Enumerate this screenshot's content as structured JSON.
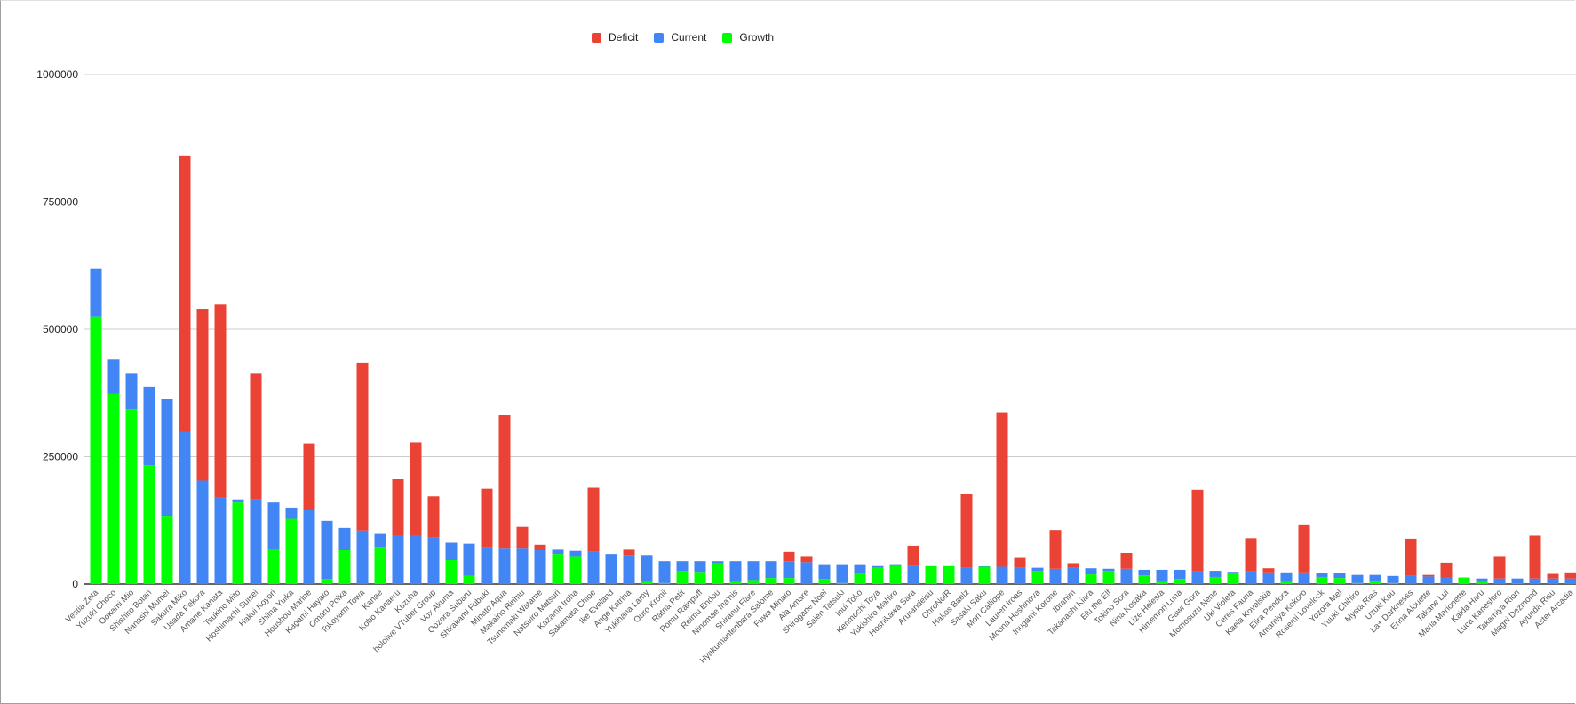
{
  "chart_data": {
    "type": "bar",
    "stacked": true,
    "title": "",
    "xlabel": "",
    "ylabel": "",
    "ylim": [
      0,
      1000000
    ],
    "yticks": [
      "0",
      "250000",
      "500000",
      "750000",
      "1000000"
    ],
    "grid": true,
    "legend_position": "top-center",
    "categories": [
      "Vestia Zeta",
      "Yuzuki Choco",
      "Ookami Mio",
      "Shishiro Botan",
      "Nanashi Mumei",
      "Sakura Miko",
      "Usada Pekora",
      "Amane Kanata",
      "Tsukino Mito",
      "Hoshimachi Suisei",
      "Hakui Koyori",
      "Shiina Yuika",
      "Houshou Marine",
      "Kagami Hayato",
      "Omaru Polka",
      "Tokoyami Towa",
      "Kanae",
      "Kobo Kanaeru",
      "Kuzuha",
      "hololive VTuber Group",
      "Vox Akuma",
      "Oozora Subaru",
      "Shirakami Fubuki",
      "Minato Aqua",
      "Makaino Ririmu",
      "Tsunomaki Watame",
      "Natsuiro Matsuri",
      "Kazama Iroha",
      "Sakamata Chloe",
      "Ike Eveland",
      "Ange Katrina",
      "Yukihana Lamy",
      "Ouro Kronii",
      "Ratna Petit",
      "Pomu Rainpuff",
      "Reimu Endou",
      "Ninomae Ina'nis",
      "Shiranui Flare",
      "Hyakumantenbara Salome",
      "Fuwa Minato",
      "Ala Amare",
      "Shirogane Noel",
      "Saien Tatsuki",
      "Inui Toko",
      "Kenmochi Toya",
      "Yukishiro Mahiro",
      "Hoshikawa Sara",
      "Arurandeisu",
      "ChroNoiR",
      "Hakos Baelz",
      "Sasaki Saku",
      "Mori Calliope",
      "Lauren Iroas",
      "Moona Hoshinova",
      "Inugami Korone",
      "Ibrahim",
      "Takanashi Kiara",
      "Elu the Elf",
      "Tokino Sora",
      "Nina Kosaka",
      "Lize Helesta",
      "Himemori Luna",
      "Gawr Gura",
      "Momosuzu Nene",
      "Uki Violeta",
      "Ceres Fauna",
      "Kaela Kovalskia",
      "Elira Pendora",
      "Amamiya Kokoro",
      "Rosemi Lovelock",
      "Yozora Mel",
      "Yuuki Chihiro",
      "Mysta Rias",
      "Uzuki Kou",
      "La+ Darknesss",
      "Enna Alouette",
      "Takane Lui",
      "Maria Marionette",
      "Kaida Haru",
      "Luca Kaneshiro",
      "Takamiya Rion",
      "Magni Dezmond",
      "Ayunda Risu",
      "Aster Arcadia"
    ],
    "series": [
      {
        "name": "Growth",
        "color": "#00ff00",
        "values": [
          525000,
          373000,
          343000,
          233000,
          134000,
          0,
          0,
          0,
          160000,
          0,
          69000,
          128000,
          0,
          10000,
          67000,
          0,
          73000,
          0,
          0,
          0,
          47000,
          16000,
          0,
          0,
          0,
          0,
          59000,
          55000,
          0,
          0,
          0,
          4000,
          2000,
          26000,
          24000,
          41000,
          4000,
          8000,
          12000,
          12000,
          0,
          10000,
          2000,
          22000,
          32000,
          37000,
          0,
          37000,
          37000,
          0,
          34000,
          0,
          0,
          26000,
          0,
          0,
          19000,
          26000,
          0,
          17000,
          4000,
          10000,
          0,
          14000,
          21000,
          0,
          0,
          4000,
          0,
          14000,
          12000,
          2000,
          5000,
          2000,
          0,
          0,
          0,
          13000,
          4000,
          0,
          1000,
          0,
          0,
          0
        ]
      },
      {
        "name": "Current",
        "color": "#4285f4",
        "values": [
          94000,
          69000,
          71000,
          154000,
          230000,
          298000,
          203000,
          170000,
          6000,
          166000,
          91000,
          22000,
          146000,
          114000,
          43000,
          105000,
          27000,
          95000,
          95000,
          91000,
          34000,
          63000,
          73000,
          71000,
          71000,
          67000,
          10000,
          10000,
          63000,
          59000,
          57000,
          53000,
          43000,
          19000,
          21000,
          4000,
          41000,
          37000,
          33000,
          33000,
          43000,
          29000,
          37000,
          17000,
          5000,
          2000,
          37000,
          0,
          0,
          33000,
          2000,
          34000,
          32000,
          6000,
          30000,
          33000,
          12000,
          4000,
          30000,
          11000,
          24000,
          18000,
          26000,
          12000,
          3000,
          25000,
          23000,
          19000,
          23000,
          7000,
          9000,
          16000,
          13000,
          14000,
          16000,
          15000,
          13000,
          0,
          7000,
          11000,
          10000,
          11000,
          11000,
          11000
        ]
      },
      {
        "name": "Deficit",
        "color": "#ea4335",
        "values": [
          0,
          0,
          0,
          0,
          0,
          542000,
          337000,
          380000,
          0,
          248000,
          0,
          0,
          130000,
          0,
          0,
          329000,
          0,
          112000,
          183000,
          81000,
          0,
          0,
          114000,
          260000,
          41000,
          10000,
          0,
          0,
          126000,
          0,
          12000,
          0,
          0,
          0,
          0,
          0,
          0,
          0,
          0,
          18000,
          12000,
          0,
          0,
          0,
          0,
          0,
          38000,
          0,
          0,
          143000,
          0,
          303000,
          21000,
          0,
          76000,
          8000,
          0,
          0,
          31000,
          0,
          0,
          0,
          159000,
          0,
          0,
          65000,
          8000,
          0,
          94000,
          0,
          0,
          0,
          0,
          0,
          73000,
          3000,
          29000,
          0,
          0,
          44000,
          0,
          84000,
          9000,
          12000
        ]
      }
    ]
  }
}
